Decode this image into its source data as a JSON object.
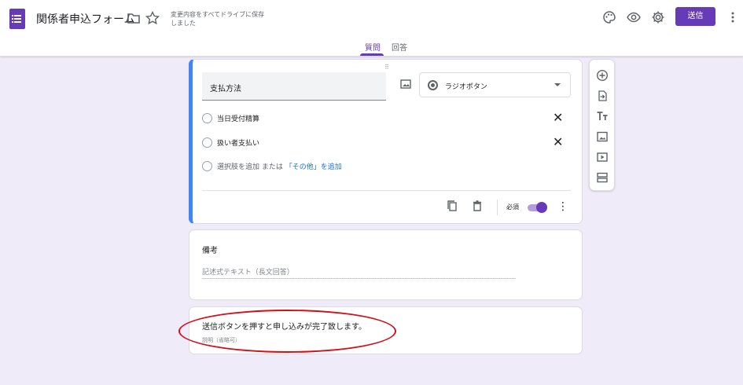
{
  "header": {
    "title": "関係者申込フォーム",
    "save_status": "変更内容をすべてドライブに保存しました",
    "send_label": "送信",
    "icons": [
      "forms-app-icon",
      "folder-icon",
      "star-icon",
      "palette-icon",
      "preview-eye-icon",
      "settings-gear-icon",
      "more-vert-icon"
    ],
    "accent_color": "#673ab7"
  },
  "tabs": [
    {
      "label": "質問",
      "active": true
    },
    {
      "label": "回答",
      "active": false
    }
  ],
  "question": {
    "title": "支払方法",
    "type_label": "ラジオボタン",
    "options": [
      {
        "label": "当日受付精算"
      },
      {
        "label": "扱い者支払い"
      }
    ],
    "add_option_label": "選択肢を追加",
    "or_label": "または",
    "add_other_label": "「その他」を追加",
    "required_label": "必須",
    "required": true
  },
  "notes_question": {
    "title": "備考",
    "placeholder": "記述式テキスト（長文回答）"
  },
  "message_block": {
    "title": "送信ボタンを押すと申し込みが完了致します。",
    "description_placeholder": "説明（省略可）"
  },
  "toolbar": {
    "icons": [
      "add-circle-icon",
      "import-icon",
      "title-text-icon",
      "image-icon",
      "video-icon",
      "section-icon"
    ]
  },
  "annotation_color": "#d0101a"
}
